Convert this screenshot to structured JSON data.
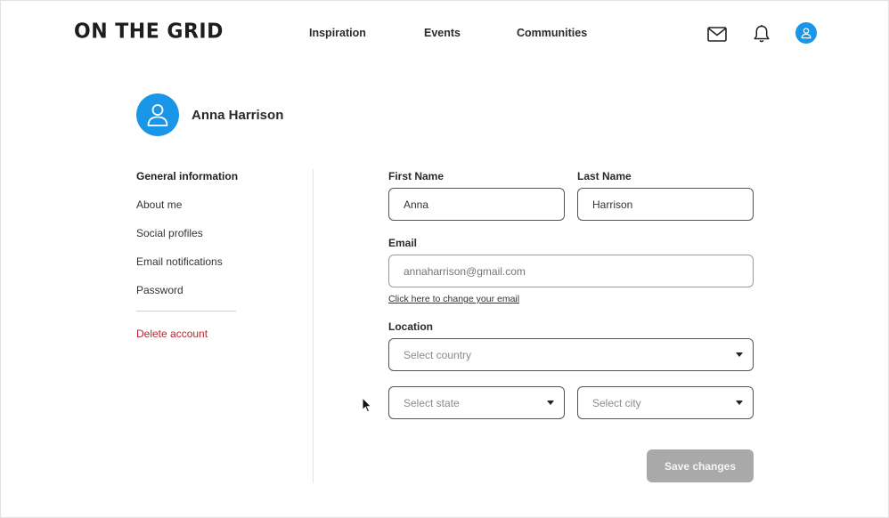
{
  "app": {
    "logo": "on the grid"
  },
  "nav": [
    {
      "label": "Inspiration"
    },
    {
      "label": "Events"
    },
    {
      "label": "Communities"
    }
  ],
  "header_icons": [
    "mail-icon",
    "bell-icon",
    "user-avatar-icon"
  ],
  "profile": {
    "name": "Anna Harrison"
  },
  "sidebar": {
    "items": [
      {
        "label": "General information",
        "active": true
      },
      {
        "label": "About me"
      },
      {
        "label": "Social profiles"
      },
      {
        "label": "Email notifications"
      },
      {
        "label": "Password"
      }
    ],
    "delete_label": "Delete account"
  },
  "form": {
    "first_name": {
      "label": "First Name",
      "value": "Anna"
    },
    "last_name": {
      "label": "Last Name",
      "value": "Harrison"
    },
    "email": {
      "label": "Email",
      "placeholder": "annaharrison@gmail.com",
      "change_link": "Click here to change your email"
    },
    "location": {
      "label": "Location",
      "country_placeholder": "Select country",
      "state_placeholder": "Select state",
      "city_placeholder": "Select city"
    },
    "save_label": "Save changes"
  },
  "colors": {
    "accent": "#1a96e8",
    "danger": "#b8262d",
    "disabled_button": "#a9a9a9"
  }
}
